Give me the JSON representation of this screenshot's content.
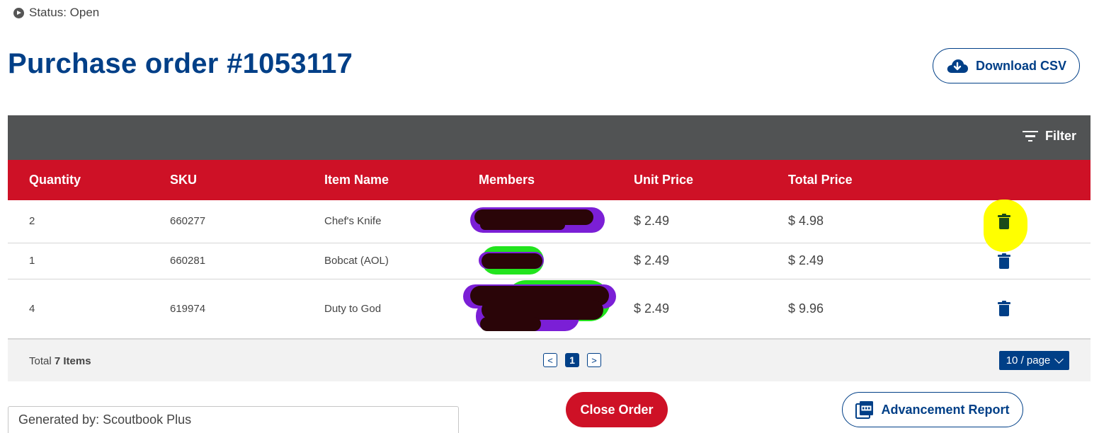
{
  "status": {
    "label": "Status: Open"
  },
  "title": "Purchase order #1053117",
  "actions": {
    "download_csv": "Download CSV",
    "filter": "Filter",
    "close_order": "Close Order",
    "advancement_report": "Advancement Report"
  },
  "table": {
    "columns": [
      "Quantity",
      "SKU",
      "Item Name",
      "Members",
      "Unit Price",
      "Total Price"
    ],
    "rows": [
      {
        "quantity": "2",
        "sku": "660277",
        "item_name": "Chef's Knife",
        "members": "",
        "unit_price": "$ 2.49",
        "total_price": "$ 4.98"
      },
      {
        "quantity": "1",
        "sku": "660281",
        "item_name": "Bobcat (AOL)",
        "members": "",
        "unit_price": "$ 2.49",
        "total_price": "$ 2.49"
      },
      {
        "quantity": "4",
        "sku": "619974",
        "item_name": "Duty to God",
        "members": "",
        "unit_price": "$ 2.49",
        "total_price": "$ 9.96"
      }
    ]
  },
  "footer": {
    "total_prefix": "Total",
    "total_count": "7 Items",
    "current_page": "1",
    "page_size": "10 / page",
    "prev": "<",
    "next": ">"
  },
  "generated_by": "Generated by: Scoutbook Plus",
  "colors": {
    "primary_blue": "#003f87",
    "header_red": "#ce1126",
    "toolbar_gray": "#515354",
    "highlight_yellow": "#ffff00"
  },
  "icons": {
    "status": "play-circle-icon",
    "download": "cloud-download-icon",
    "filter": "filter-icon",
    "delete": "trash-icon",
    "report": "pdf-icon",
    "page_size": "chevron-down-icon"
  }
}
